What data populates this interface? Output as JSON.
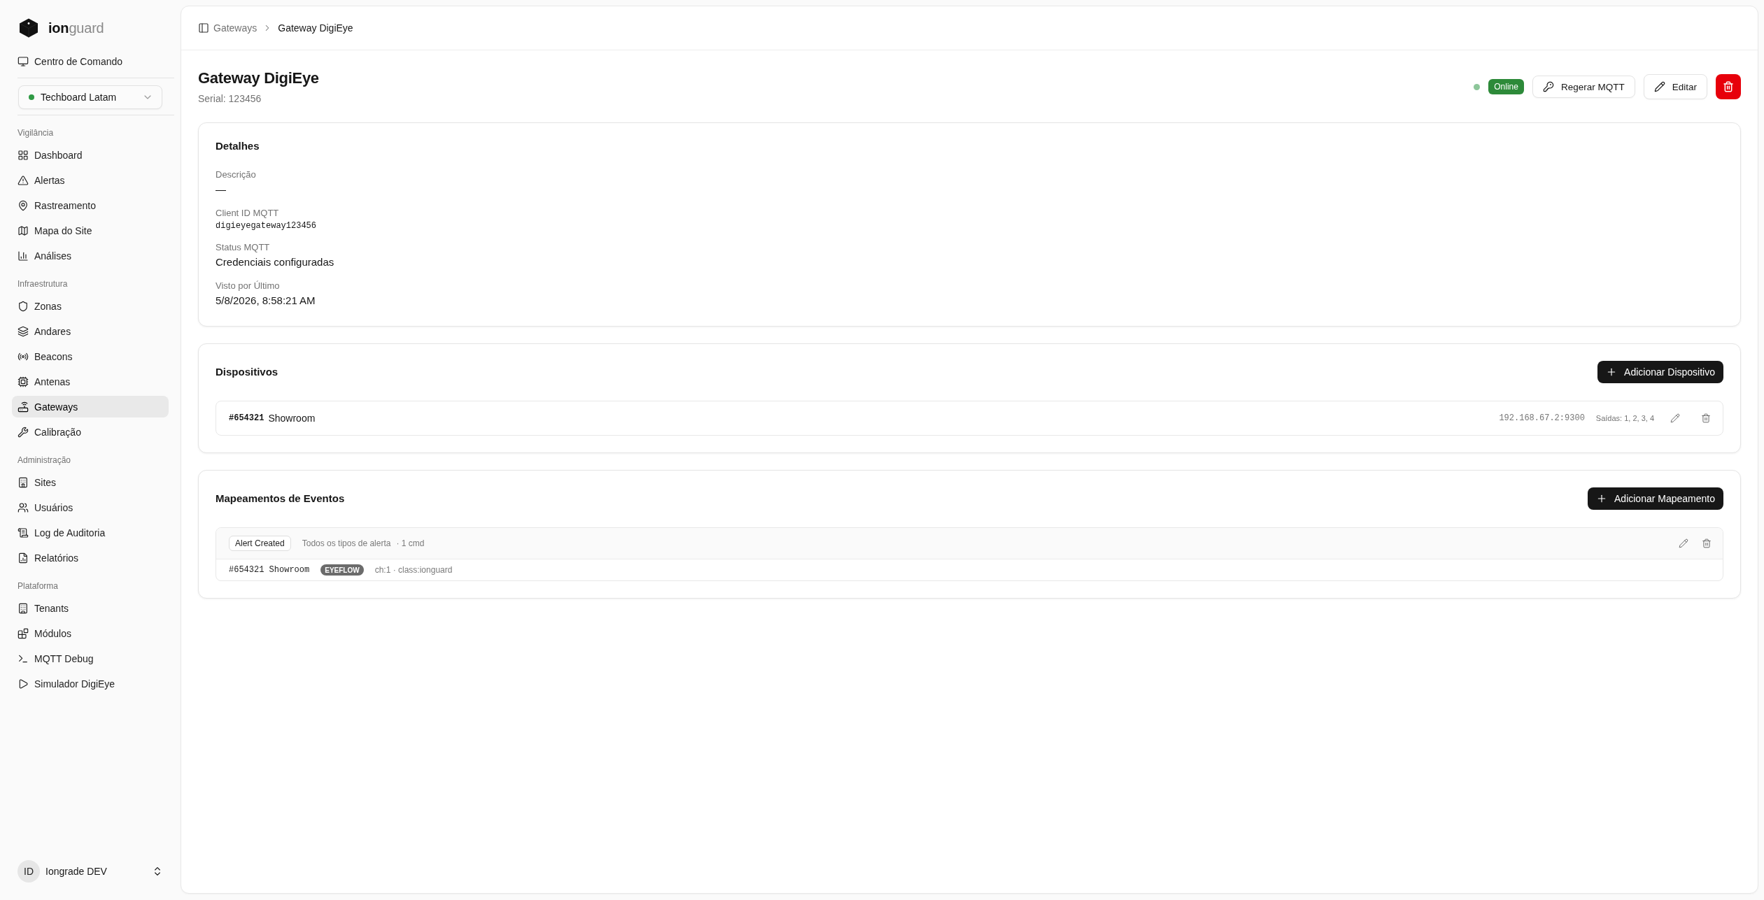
{
  "sidebar": {
    "brand": "**ion**guard",
    "command_center": "Centro de Comando",
    "tenant_select": {
      "value": "Techboard Latam"
    },
    "sections": [
      {
        "title": "Vigilância",
        "items": [
          {
            "label": "Dashboard",
            "selected": false
          },
          {
            "label": "Alertas",
            "selected": false
          },
          {
            "label": "Rastreamento",
            "selected": false
          },
          {
            "label": "Mapa do Site",
            "selected": false
          },
          {
            "label": "Análises",
            "selected": false
          }
        ]
      },
      {
        "title": "Infraestrutura",
        "items": [
          {
            "label": "Zonas",
            "selected": false
          },
          {
            "label": "Andares",
            "selected": false
          },
          {
            "label": "Beacons",
            "selected": false
          },
          {
            "label": "Antenas",
            "selected": false
          },
          {
            "label": "Gateways",
            "selected": true
          },
          {
            "label": "Calibração",
            "selected": false
          }
        ]
      },
      {
        "title": "Administração",
        "items": [
          {
            "label": "Sites",
            "selected": false
          },
          {
            "label": "Usuários",
            "selected": false
          },
          {
            "label": "Log de Auditoria",
            "selected": false
          },
          {
            "label": "Relatórios",
            "selected": false
          }
        ]
      },
      {
        "title": "Plataforma",
        "items": [
          {
            "label": "Tenants",
            "selected": false
          },
          {
            "label": "Módulos",
            "selected": false
          },
          {
            "label": "MQTT Debug",
            "selected": false
          },
          {
            "label": "Simulador DigiEye",
            "selected": false
          }
        ]
      }
    ],
    "user": {
      "initials": "ID",
      "name": "Iongrade DEV"
    }
  },
  "breadcrumb": [
    {
      "label": "Gateways",
      "current": false
    },
    {
      "label": "Gateway DigiEye",
      "current": true
    }
  ],
  "page_header": {
    "title": "Gateway DigiEye",
    "subtitle": "Serial: 123456",
    "status": {
      "label": "Online",
      "online": true
    },
    "mqtt_button": "Regerar MQTT",
    "edit_button": "Editar"
  },
  "details": {
    "title": "Detalhes",
    "fields": [
      {
        "label": "Descrição",
        "value": "—",
        "kind": "text"
      },
      {
        "label": "Client ID MQTT",
        "value": "digieyegateway123456",
        "kind": "code"
      },
      {
        "label": "Status MQTT",
        "value": "Credenciais configuradas",
        "kind": "text"
      },
      {
        "label": "Visto por Último",
        "value": "5/8/2026, 8:58:21 AM",
        "kind": "text"
      }
    ]
  },
  "devices": {
    "title": "Dispositivos",
    "add_button": "Adicionar Dispositivo",
    "rows": [
      {
        "id": "#654321",
        "name": "Showroom",
        "address": "192.168.67.2:9300",
        "outputs": "Saídas: 1, 2, 3, 4"
      }
    ]
  },
  "event_mappings": {
    "title": "Mapeamentos de Eventos",
    "add_button": "Adicionar Mapeamento",
    "rows": [
      {
        "event": "Alert Created",
        "scope": "Todos os tipos de alerta",
        "count": "· 1 cmd",
        "commands": [
          {
            "target": "#654321 Showroom",
            "type": "EYEFLOW",
            "params": "ch:1 · class:ionguard"
          }
        ]
      }
    ]
  }
}
